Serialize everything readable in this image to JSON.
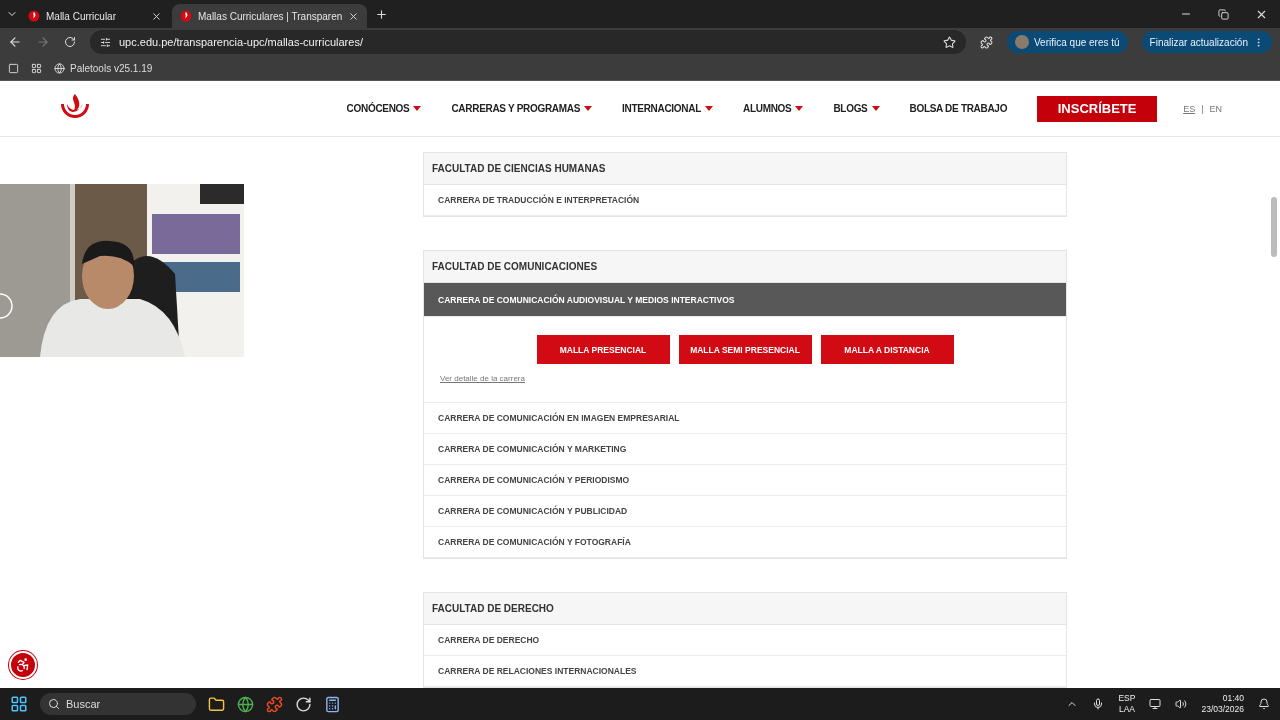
{
  "browser": {
    "tabs": [
      {
        "title": "Malla Curricular",
        "selected": false
      },
      {
        "title": "Mallas Curriculares | Transparen",
        "selected": true
      }
    ],
    "url": "upc.edu.pe/transparencia-upc/mallas-curriculares/",
    "bookmarks": [
      "Paletools v25.1.19"
    ],
    "profile_button": "Verifica que eres tú",
    "update_button": "Finalizar actualización"
  },
  "site": {
    "nav": [
      {
        "label": "CONÓCENOS",
        "has_menu": true
      },
      {
        "label": "CARRERAS Y PROGRAMAS",
        "has_menu": true
      },
      {
        "label": "INTERNACIONAL",
        "has_menu": true
      },
      {
        "label": "ALUMNOS",
        "has_menu": true
      },
      {
        "label": "BLOGS",
        "has_menu": true
      },
      {
        "label": "BOLSA DE TRABAJO",
        "has_menu": false
      }
    ],
    "cta": "INSCRÍBETE",
    "languages": [
      {
        "label": "ES",
        "selected": true
      },
      {
        "label": "EN",
        "selected": false
      }
    ],
    "language_separator": "|",
    "faculties": [
      {
        "title": "FACULTAD DE CIENCIAS HUMANAS",
        "careers": [
          {
            "name": "CARRERA DE TRADUCCIÓN E INTERPRETACIÓN",
            "expanded": false
          }
        ]
      },
      {
        "title": "FACULTAD DE COMUNICACIONES",
        "careers": [
          {
            "name": "CARRERA DE COMUNICACIÓN AUDIOVISUAL Y MEDIOS INTERACTIVOS",
            "expanded": true,
            "buttons": [
              "MALLA PRESENCIAL",
              "MALLA SEMI PRESENCIAL",
              "MALLA A DISTANCIA"
            ],
            "link": "Ver detalle de la carrera"
          },
          {
            "name": "CARRERA DE COMUNICACIÓN EN IMAGEN EMPRESARIAL",
            "expanded": false
          },
          {
            "name": "CARRERA DE COMUNICACIÓN Y MARKETING",
            "expanded": false
          },
          {
            "name": "CARRERA DE COMUNICACIÓN Y PERIODISMO",
            "expanded": false
          },
          {
            "name": "CARRERA DE COMUNICACIÓN Y PUBLICIDAD",
            "expanded": false
          },
          {
            "name": "CARRERA DE COMUNICACIÓN Y FOTOGRAFÍA",
            "expanded": false
          }
        ]
      },
      {
        "title": "FACULTAD DE DERECHO",
        "careers": [
          {
            "name": "CARRERA DE DERECHO",
            "expanded": false
          },
          {
            "name": "CARRERA DE RELACIONES INTERNACIONALES",
            "expanded": false
          }
        ]
      }
    ]
  },
  "taskbar": {
    "search": {
      "placeholder": "Buscar"
    },
    "language": [
      "ESP",
      "LAA"
    ],
    "time": "01:40",
    "date": "23/03/2026"
  }
}
